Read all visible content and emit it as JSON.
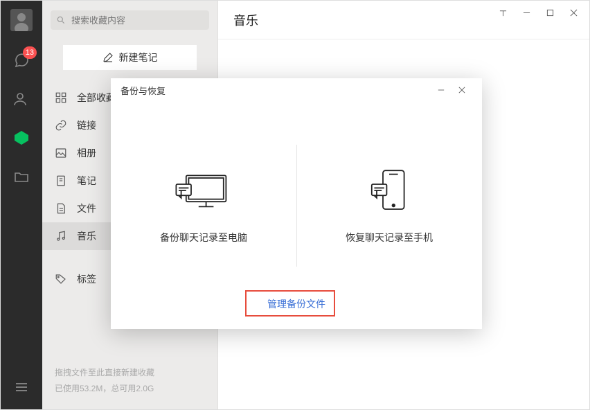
{
  "rail": {
    "chat_badge": "13"
  },
  "sidebar": {
    "search_placeholder": "搜索收藏内容",
    "new_note": "新建笔记",
    "items": [
      {
        "label": "全部收藏"
      },
      {
        "label": "链接"
      },
      {
        "label": "相册"
      },
      {
        "label": "笔记"
      },
      {
        "label": "文件"
      },
      {
        "label": "音乐"
      },
      {
        "label": "标签"
      }
    ],
    "footer_line1": "拖拽文件至此直接新建收藏",
    "footer_line2": "已使用53.2M，总可用2.0G"
  },
  "main": {
    "title": "音乐"
  },
  "dialog": {
    "title": "备份与恢复",
    "backup_label": "备份聊天记录至电脑",
    "restore_label": "恢复聊天记录至手机",
    "manage_label": "管理备份文件"
  }
}
